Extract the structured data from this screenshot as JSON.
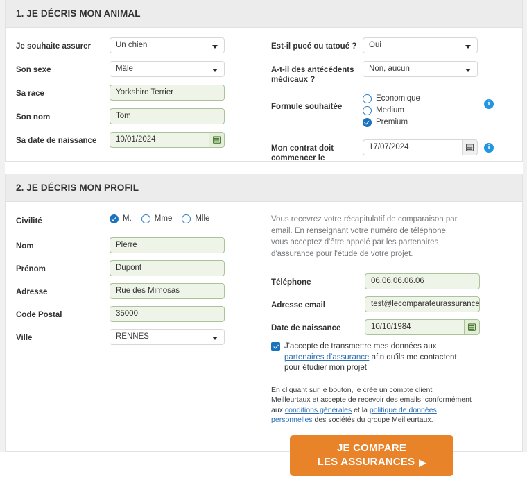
{
  "theme": {
    "accent_orange": "#e8832a",
    "accent_blue": "#1b72bd",
    "field_green_bg": "#eef4e7",
    "field_green_border": "#aac39a",
    "panel_header_bg": "#ececec",
    "page_bg": "#f1f1f1",
    "link_color": "#2c6fb5"
  },
  "section_animal": {
    "title": "1. JE DÉCRIS MON ANIMAL",
    "fields": {
      "animal_type": {
        "label": "Je souhaite assurer",
        "value": "Un chien"
      },
      "sex": {
        "label": "Son sexe",
        "value": "Mâle"
      },
      "breed": {
        "label": "Sa race",
        "value": "Yorkshire Terrier"
      },
      "name": {
        "label": "Son nom",
        "value": "Tom"
      },
      "birthdate": {
        "label": "Sa date de naissance",
        "value": "10/01/2024"
      },
      "chipped": {
        "label": "Est-il pucé ou tatoué ?",
        "value": "Oui"
      },
      "medical_history": {
        "label": "A-t-il des antécédents médicaux ?",
        "value": "Non, aucun"
      },
      "formula": {
        "label": "Formule souhaitée",
        "options": [
          {
            "label": "Economique",
            "checked": false
          },
          {
            "label": "Medium",
            "checked": false
          },
          {
            "label": "Premium",
            "checked": true
          }
        ]
      },
      "contract_start": {
        "label": "Mon contrat doit commencer le",
        "value": "17/07/2024"
      }
    }
  },
  "section_profile": {
    "title": "2. JE DÉCRIS MON PROFIL",
    "fields": {
      "civility": {
        "label": "Civilité",
        "options": [
          {
            "label": "M.",
            "checked": true
          },
          {
            "label": "Mme",
            "checked": false
          },
          {
            "label": "Mlle",
            "checked": false
          }
        ]
      },
      "nom": {
        "label": "Nom",
        "value": "Pierre"
      },
      "prenom": {
        "label": "Prénom",
        "value": "Dupont"
      },
      "adresse": {
        "label": "Adresse",
        "value": "Rue des Mimosas"
      },
      "code_postal": {
        "label": "Code Postal",
        "value": "35000"
      },
      "ville": {
        "label": "Ville",
        "value": "RENNES"
      },
      "telephone": {
        "label": "Téléphone",
        "value": "06.06.06.06.06"
      },
      "email": {
        "label": "Adresse email",
        "value": "test@lecomparateurassurance.c"
      },
      "date_naissance": {
        "label": "Date de naissance",
        "value": "10/10/1984"
      }
    },
    "intro_text": "Vous recevrez votre récapitulatif de comparaison par email. En renseignant votre numéro de téléphone, vous acceptez d'être appelé par les partenaires d'assurance pour l'étude de votre projet.",
    "consent": {
      "checked": true,
      "text_before": "J'accepte de transmettre mes données aux ",
      "link_text": "partenaires d'assurance",
      "text_after": " afin qu'ils me contactent pour étudier mon projet"
    },
    "legal": {
      "part1": "En cliquant sur le bouton, je crée un compte client Meilleurtaux et accepte de recevoir des emails, conformément aux ",
      "link1": "conditions générales",
      "part2": " et la ",
      "link2": "politique de données personnelles",
      "part3": " des sociétés du groupe Meilleurtaux."
    },
    "cta": {
      "line1": "JE COMPARE",
      "line2": "LES ASSURANCES",
      "arrow": "▶"
    }
  }
}
